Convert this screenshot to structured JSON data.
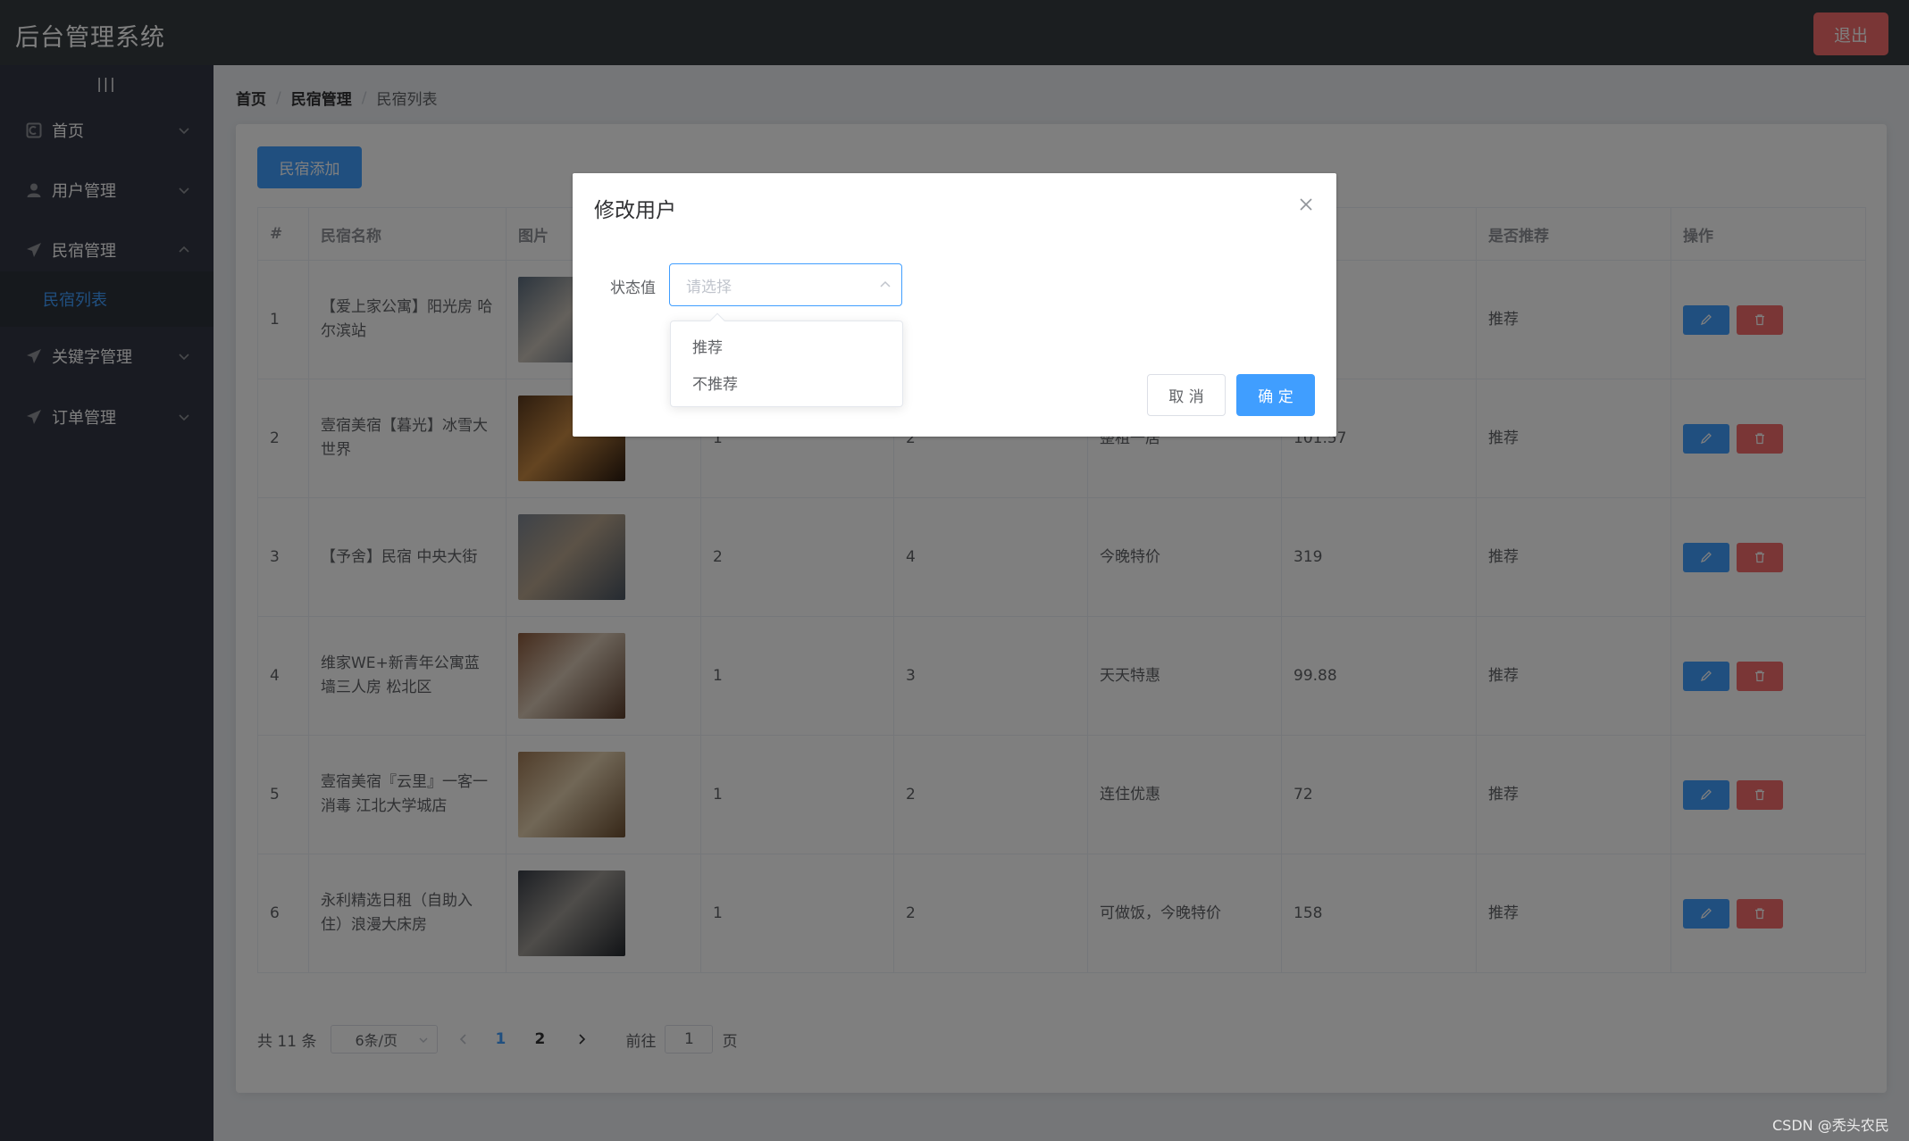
{
  "header": {
    "app_title": "后台管理系统",
    "logout_label": "退出"
  },
  "sidebar": {
    "toggle_label": "|||",
    "items": [
      {
        "label": "首页",
        "icon": "home-icon"
      },
      {
        "label": "用户管理",
        "icon": "user-icon"
      },
      {
        "label": "民宿管理",
        "icon": "send-icon"
      },
      {
        "label": "关键字管理",
        "icon": "send-icon"
      },
      {
        "label": "订单管理",
        "icon": "send-icon"
      }
    ],
    "active_subitem": "民宿列表"
  },
  "breadcrumb": {
    "home": "首页",
    "section": "民宿管理",
    "current": "民宿列表",
    "separator": "/"
  },
  "toolbar": {
    "add_label": "民宿添加"
  },
  "table": {
    "columns": [
      "#",
      "民宿名称",
      "图片",
      "",
      "",
      "",
      "",
      "是否推荐",
      "操作"
    ],
    "rows": [
      {
        "index": "1",
        "name": "【爱上家公寓】阳光房 哈尔滨站",
        "c1": "",
        "c2": "",
        "tag": "",
        "price": "",
        "recommend": "推荐",
        "thumb_colors": [
          "#5a6b7d",
          "#c9c2b8",
          "#3e4f66"
        ]
      },
      {
        "index": "2",
        "name": "壹宿美宿【暮光】冰雪大世界",
        "c1": "1",
        "c2": "2",
        "tag": "整租一居",
        "price": "101.57",
        "recommend": "推荐",
        "thumb_colors": [
          "#5b3a1e",
          "#c98a43",
          "#2a1a0f"
        ]
      },
      {
        "index": "3",
        "name": "【予舍】民宿 中央大街",
        "c1": "2",
        "c2": "4",
        "tag": "今晚特价",
        "price": "319",
        "recommend": "推荐",
        "thumb_colors": [
          "#7d8590",
          "#b8a58e",
          "#4a5562"
        ]
      },
      {
        "index": "4",
        "name": "维家WE+新青年公寓蓝墙三人房 松北区",
        "c1": "1",
        "c2": "3",
        "tag": "天天特惠",
        "price": "99.88",
        "recommend": "推荐",
        "thumb_colors": [
          "#8c5a3c",
          "#d8c7b4",
          "#5b3d2b"
        ]
      },
      {
        "index": "5",
        "name": "壹宿美宿『云里』一客一消毒 江北大学城店",
        "c1": "1",
        "c2": "2",
        "tag": "连住优惠",
        "price": "72",
        "recommend": "推荐",
        "thumb_colors": [
          "#a07a55",
          "#e3cfae",
          "#6d4f31"
        ]
      },
      {
        "index": "6",
        "name": "永利精选日租（自助入住）浪漫大床房",
        "c1": "1",
        "c2": "2",
        "tag": "可做饭，今晚特价",
        "price": "158",
        "recommend": "推荐",
        "thumb_colors": [
          "#3a3f48",
          "#9e9a94",
          "#24282e"
        ]
      }
    ]
  },
  "pagination": {
    "total_label": "共 11 条",
    "page_size": "6条/页",
    "pages": [
      "1",
      "2"
    ],
    "current_page": "1",
    "jump_prefix": "前往",
    "jump_value": "1",
    "jump_suffix": "页"
  },
  "dialog": {
    "title": "修改用户",
    "field_label": "状态值",
    "select_placeholder": "请选择",
    "options": [
      "推荐",
      "不推荐"
    ],
    "cancel_label": "取 消",
    "confirm_label": "确 定"
  },
  "watermark": "CSDN @秃头农民",
  "colors": {
    "primary": "#409eff",
    "danger": "#f56c6c",
    "header_bg": "#373d41",
    "sidebar_bg": "#333744",
    "main_bg": "#eaedf1"
  }
}
